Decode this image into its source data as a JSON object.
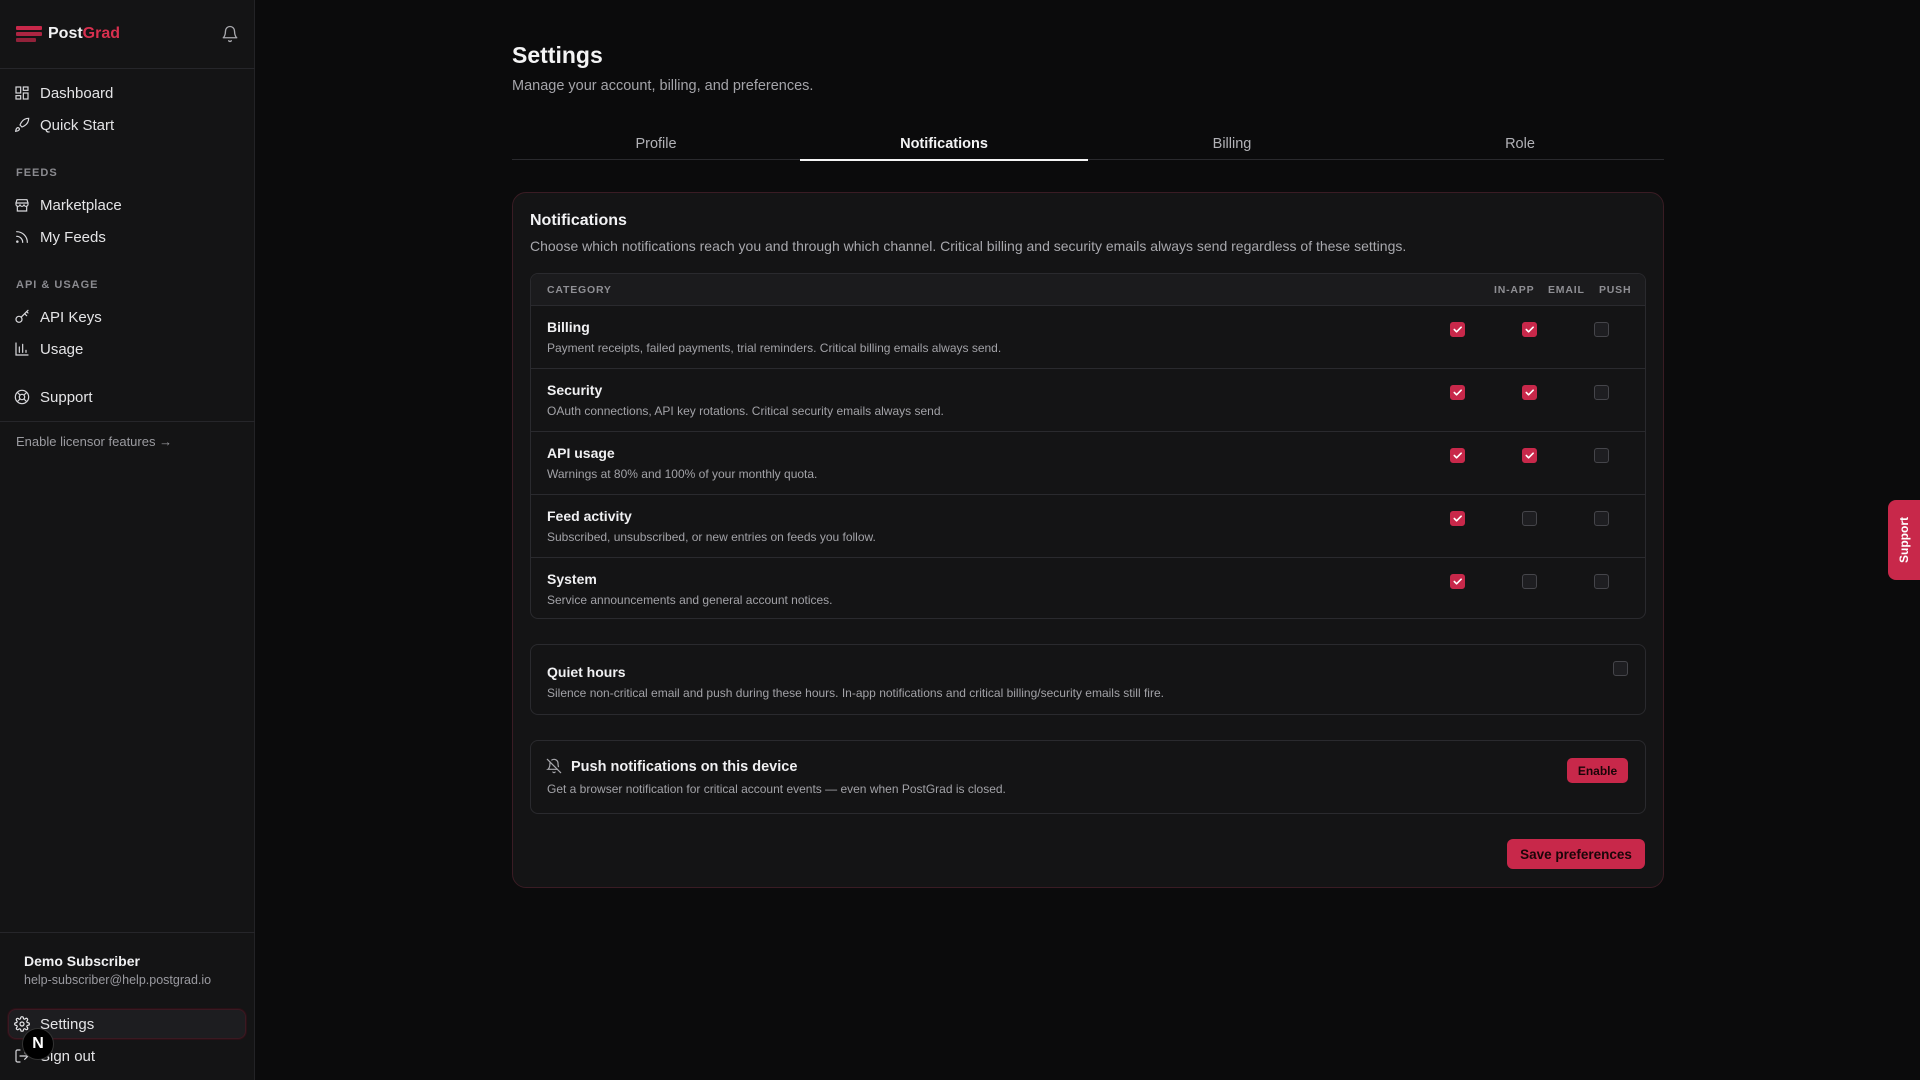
{
  "brand": {
    "name_part1": "Post",
    "name_part2": "Grad",
    "accent_color": "#c8284a"
  },
  "sidebar": {
    "items_top": [
      {
        "label": "Dashboard",
        "icon": "dashboard-icon"
      },
      {
        "label": "Quick Start",
        "icon": "rocket-icon"
      }
    ],
    "sections": [
      {
        "label": "FEEDS",
        "items": [
          {
            "label": "Marketplace",
            "icon": "store-icon"
          },
          {
            "label": "My Feeds",
            "icon": "rss-icon"
          }
        ]
      },
      {
        "label": "API & USAGE",
        "items": [
          {
            "label": "API Keys",
            "icon": "key-icon"
          },
          {
            "label": "Usage",
            "icon": "bar-chart-icon"
          }
        ]
      }
    ],
    "support_label": "Support",
    "licensor_link": "Enable licensor features →",
    "user": {
      "name": "Demo Subscriber",
      "email": "help-subscriber@help.postgrad.io"
    },
    "settings_label": "Settings",
    "signout_label": "Sign out",
    "avatar_initial": "N"
  },
  "page": {
    "title": "Settings",
    "subtitle": "Manage your account, billing, and preferences.",
    "tabs": [
      "Profile",
      "Notifications",
      "Billing",
      "Role"
    ],
    "active_tab": "Notifications"
  },
  "notifications": {
    "title": "Notifications",
    "description": "Choose which notifications reach you and through which channel. Critical billing and security emails always send regardless of these settings.",
    "columns": {
      "category": "CATEGORY",
      "inapp": "IN-APP",
      "email": "EMAIL",
      "push": "PUSH"
    },
    "rows": [
      {
        "title": "Billing",
        "desc": "Payment receipts, failed payments, trial reminders. Critical billing emails always send.",
        "inapp": true,
        "email": true,
        "push": false
      },
      {
        "title": "Security",
        "desc": "OAuth connections, API key rotations. Critical security emails always send.",
        "inapp": true,
        "email": true,
        "push": false
      },
      {
        "title": "API usage",
        "desc": "Warnings at 80% and 100% of your monthly quota.",
        "inapp": true,
        "email": true,
        "push": false
      },
      {
        "title": "Feed activity",
        "desc": "Subscribed, unsubscribed, or new entries on feeds you follow.",
        "inapp": true,
        "email": false,
        "push": false
      },
      {
        "title": "System",
        "desc": "Service announcements and general account notices.",
        "inapp": true,
        "email": false,
        "push": false
      }
    ],
    "quiet_hours": {
      "title": "Quiet hours",
      "desc": "Silence non-critical email and push during these hours. In-app notifications and critical billing/security emails still fire.",
      "enabled": false
    },
    "push_device": {
      "title": "Push notifications on this device",
      "desc": "Get a browser notification for critical account events — even when PostGrad is closed.",
      "button": "Enable"
    },
    "save_button": "Save preferences"
  },
  "support_tab": "Support"
}
